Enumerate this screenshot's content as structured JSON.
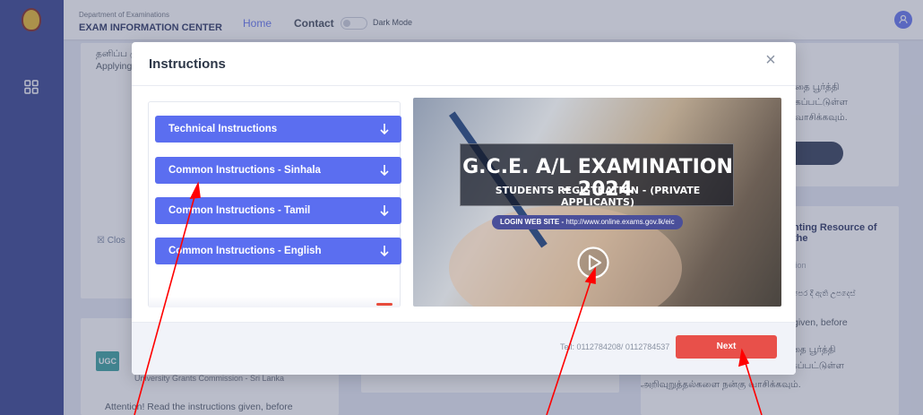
{
  "header": {
    "department": "Department of Examinations",
    "center_name": "EXAM INFORMATION CENTER",
    "nav_home": "Home",
    "nav_contact": "Contact",
    "dark_mode_label": "Dark Mode"
  },
  "background": {
    "card1_text": "தனிப்ப முறறா அவ்வா பெறுே காலங் தடை வ Applying a studen prohibite subjecte and deba",
    "card1_close": "Clos",
    "card4_line1": "தை பூர்த்தி",
    "card4_line2": "கப்பட்டுள்ள",
    "card4_line3": "வாசிக்கவும்.",
    "card5_heading": "nting Resource of the",
    "card5_sub": "tion",
    "card5_sinhala": ". පෙර දී ඇති උපදෙස්",
    "card5_given": "given, before",
    "card5_line1": "தை பூர்த்தி",
    "card5_line2": "கப்பட்டுள்ள",
    "card5_line3": "அறிவுறுத்தல்களை நன்கு வாசிக்கவும்.",
    "ugc_badge": "UGC",
    "ugc_name": "University Grants Commission - Sri Lanka",
    "attention": "Attention! Read the instructions given, before"
  },
  "modal": {
    "title": "Instructions",
    "close_symbol": "×",
    "accordion": [
      {
        "label": "Technical Instructions"
      },
      {
        "label": "Common Instructions - Sinhala"
      },
      {
        "label": "Common Instructions - Tamil"
      },
      {
        "label": "Common Instructions - English"
      }
    ],
    "video": {
      "title": "G.C.E. A/L EXAMINATION - 2024",
      "subtitle": "STUDENTS REGISTRATION - (PRIVATE APPLICANTS)",
      "login_label": "LOGIN WEB SITE -",
      "login_url": "http://www.online.exams.gov.lk/eic"
    },
    "tel": "Tell: 0112784208/ 0112784537",
    "next_label": "Next"
  },
  "colors": {
    "accent_blue": "#5b6ef0",
    "next_red": "#e8504a",
    "sidebar": "#2c3a8a",
    "annotation_arrow": "#ff0000"
  },
  "icons": {
    "sidebar_logo": "emblem-icon",
    "sidebar_nav": "grid-icon",
    "accordion_arrow": "arrow-down-icon",
    "video_play": "play-icon",
    "modal_close": "close-icon",
    "user": "user-icon"
  }
}
